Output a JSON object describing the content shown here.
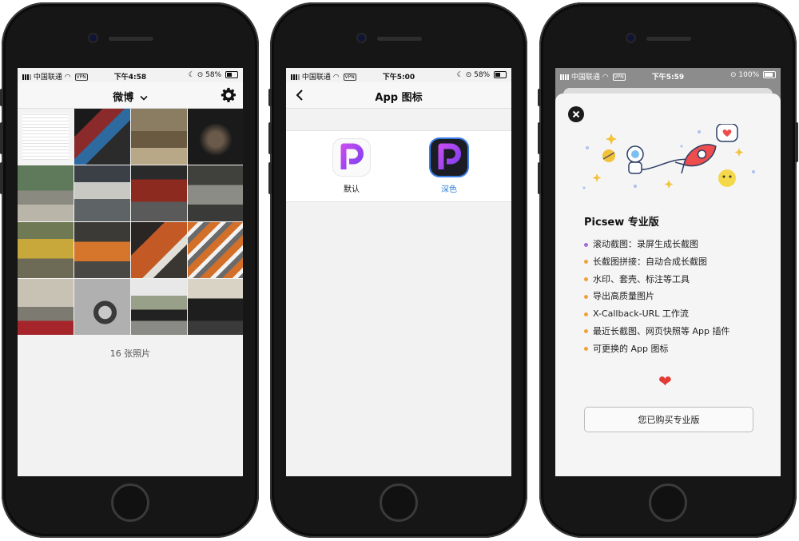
{
  "screens": [
    {
      "status": {
        "carrier": "中国联通",
        "vpn": "VPN",
        "time": "下午4:58",
        "battery": "58%"
      },
      "header": {
        "title": "微博",
        "chevron": "chevron-down-icon",
        "settings_icon": "gear-icon"
      },
      "photos": [
        {
          "name": "text-document"
        },
        {
          "name": "dark-collage"
        },
        {
          "name": "desert-car"
        },
        {
          "name": "dark-dashboard"
        },
        {
          "name": "street-old-car"
        },
        {
          "name": "bmw-garage"
        },
        {
          "name": "red-classic-car"
        },
        {
          "name": "gray-sedan"
        },
        {
          "name": "yellow-car"
        },
        {
          "name": "orange-car"
        },
        {
          "name": "orange-car-detail"
        },
        {
          "name": "orange-car-blurred"
        },
        {
          "name": "red-convertible"
        },
        {
          "name": "silver-wheel"
        },
        {
          "name": "black-car-street"
        },
        {
          "name": "black-car-dusk"
        }
      ],
      "footer_count": "16 张照片"
    },
    {
      "status": {
        "carrier": "中国联通",
        "vpn": "VPN",
        "time": "下午5:00",
        "battery": "58%"
      },
      "header": {
        "title": "App 图标",
        "back_icon": "chevron-left-icon"
      },
      "icons": [
        {
          "label": "默认",
          "style": "light",
          "letter": "P"
        },
        {
          "label": "深色",
          "style": "dark",
          "letter": "P"
        }
      ]
    },
    {
      "status": {
        "carrier": "中国联通",
        "vpn": "VPN",
        "time": "下午5:59",
        "battery": "100%"
      },
      "sheet": {
        "close_icon": "close-icon",
        "title": "Picsew 专业版",
        "features": [
          {
            "text": "滚动截图：录屏生成长截图",
            "color": "#a86ad6"
          },
          {
            "text": "长截图拼接：自动合成长截图",
            "color": "#f0a23a"
          },
          {
            "text": "水印、套壳、标注等工具",
            "color": "#f0a23a"
          },
          {
            "text": "导出高质量图片",
            "color": "#f0a23a"
          },
          {
            "text": "X-Callback-URL 工作流",
            "color": "#f0a23a"
          },
          {
            "text": "最近长截图、网页快照等 App 插件",
            "color": "#f0a23a"
          },
          {
            "text": "可更换的 App 图标",
            "color": "#f0a23a"
          }
        ],
        "heart": "❤",
        "button": "您已购买专业版"
      }
    }
  ]
}
